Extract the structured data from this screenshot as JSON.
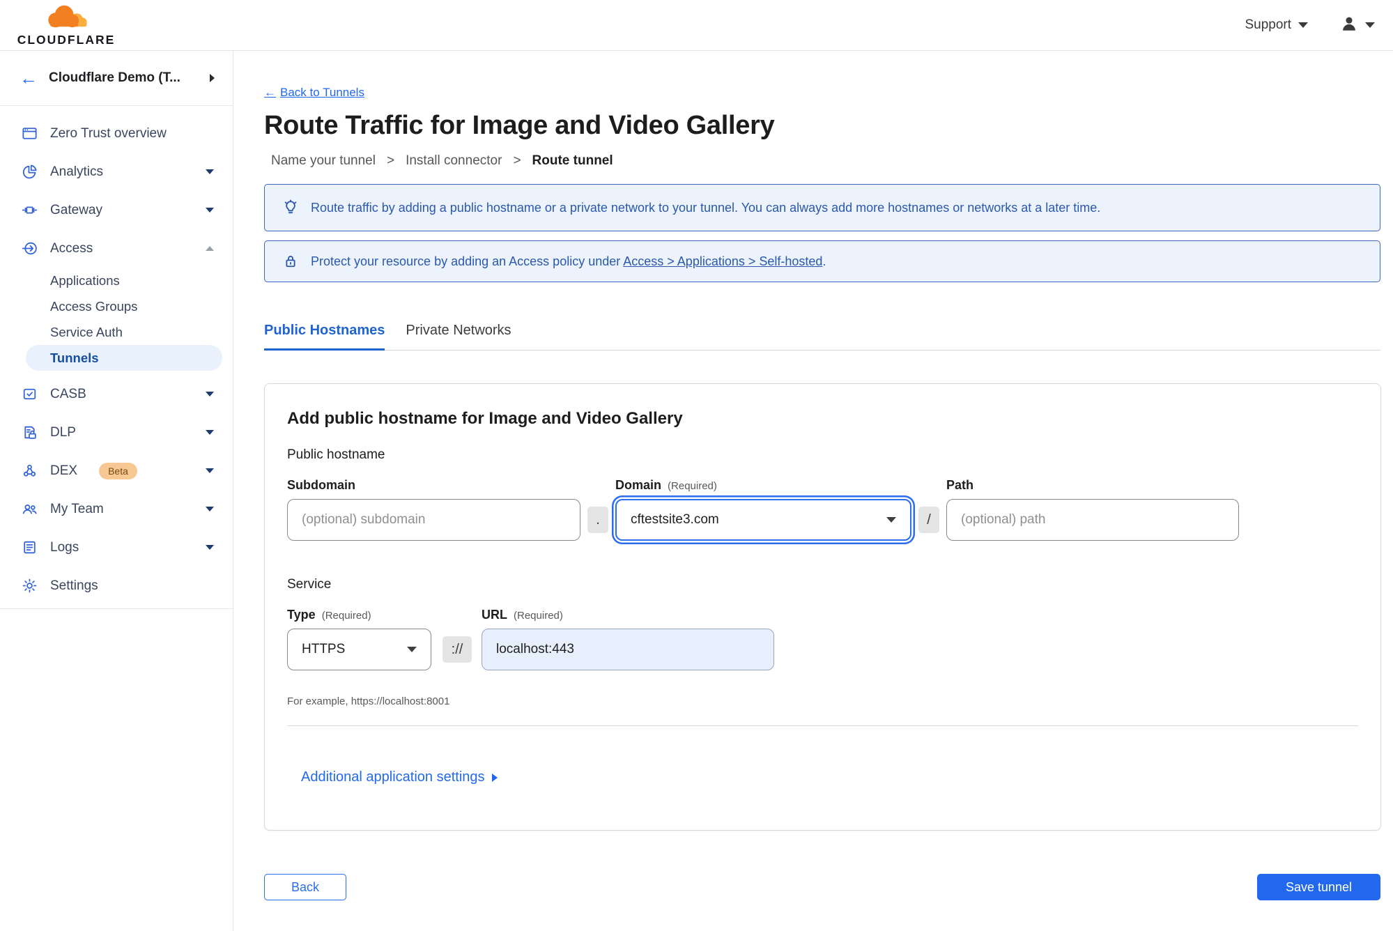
{
  "header": {
    "logo_text": "CLOUDFLARE",
    "support_label": "Support"
  },
  "sidebar": {
    "account_name": "Cloudflare Demo (T...",
    "items": [
      {
        "label": "Zero Trust overview"
      },
      {
        "label": "Analytics"
      },
      {
        "label": "Gateway"
      },
      {
        "label": "Access"
      },
      {
        "label": "CASB"
      },
      {
        "label": "DLP"
      },
      {
        "label": "DEX",
        "badge": "Beta"
      },
      {
        "label": "My Team"
      },
      {
        "label": "Logs"
      },
      {
        "label": "Settings"
      }
    ],
    "access_children": [
      {
        "label": "Applications"
      },
      {
        "label": "Access Groups"
      },
      {
        "label": "Service Auth"
      },
      {
        "label": "Tunnels",
        "selected": true
      }
    ]
  },
  "main": {
    "back_arrow": "←",
    "back_link": "Back to Tunnels",
    "title": "Route Traffic for Image and Video Gallery",
    "steps": [
      "Name your tunnel",
      "Install connector",
      "Route tunnel"
    ],
    "step_separator": ">",
    "banners": {
      "info": "Route traffic by adding a public hostname or a private network to your tunnel. You can always add more hostnames or networks at a later time.",
      "protect_prefix": "Protect your resource by adding an Access policy under",
      "protect_link": "Access > Applications > Self-hosted",
      "protect_suffix": "."
    },
    "tabs": [
      {
        "label": "Public Hostnames",
        "active": true
      },
      {
        "label": "Private Networks",
        "active": false
      }
    ],
    "form": {
      "heading": "Add public hostname for Image and Video Gallery",
      "public_hostname_section": "Public hostname",
      "subdomain_label": "Subdomain",
      "subdomain_placeholder": "(optional) subdomain",
      "dot_separator": ".",
      "domain_label": "Domain",
      "required_note": "(Required)",
      "domain_value": "cftestsite3.com",
      "slash_separator": "/",
      "path_label": "Path",
      "path_placeholder": "(optional) path",
      "service_section": "Service",
      "type_label": "Type",
      "type_value": "HTTPS",
      "scheme_separator": "://",
      "url_label": "URL",
      "url_value": "localhost:443",
      "url_example": "For example, https://localhost:8001",
      "additional_settings": "Additional application settings"
    },
    "actions": {
      "back": "Back",
      "save": "Save tunnel"
    }
  },
  "colors": {
    "accent_blue": "#2268ef",
    "sidebar_icon_blue": "#3464d6",
    "banner_border": "#3c66c4",
    "banner_bg": "#ecf3fc",
    "banner_text": "#2b58ad",
    "selected_pill_bg": "#e9f2fc",
    "beta_badge_bg": "#f7c893",
    "logo_orange": "#f38020",
    "logo_light_orange": "#faae40"
  }
}
